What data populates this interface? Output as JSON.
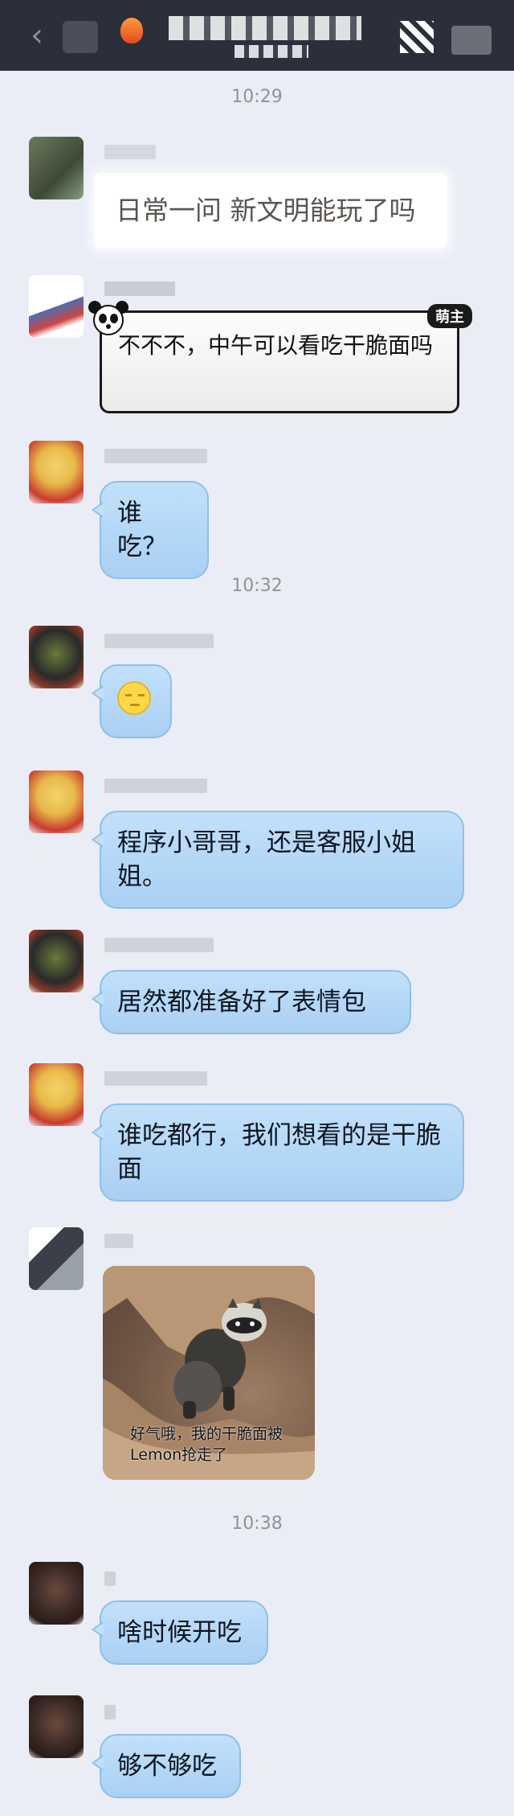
{
  "header": {
    "back_icon": "chevron-left-icon",
    "right_icon": "group-icon"
  },
  "timestamps": [
    "10:29",
    "10:32",
    "10:38"
  ],
  "messages": [
    {
      "text": "日常一问 新文明能玩了吗",
      "style": "white"
    },
    {
      "text": "不不不，中午可以看吃干脆面吗",
      "style": "panda-border",
      "badge": "萌主"
    },
    {
      "text": "谁吃？",
      "style": "blue"
    },
    {
      "text": "",
      "style": "emoji",
      "emoji": "sleepy-face-emoji"
    },
    {
      "text": "程序小哥哥，还是客服小姐姐。",
      "style": "blue"
    },
    {
      "text": "居然都准备好了表情包",
      "style": "blue"
    },
    {
      "text": "谁吃都行，我们想看的是干脆面",
      "style": "blue"
    },
    {
      "text": "好气哦，我的干脆面被Lemon抢走了",
      "style": "image-sticker"
    },
    {
      "text": "啥时候开吃",
      "style": "blue"
    },
    {
      "text": "够不够吃",
      "style": "blue"
    }
  ],
  "colors": {
    "background": "#eaedf6",
    "topbar": "#2a2f3a",
    "bubble_blue": "#b5d8f7",
    "bubble_border": "#8fbfe9",
    "timestamp": "#8d929c"
  }
}
